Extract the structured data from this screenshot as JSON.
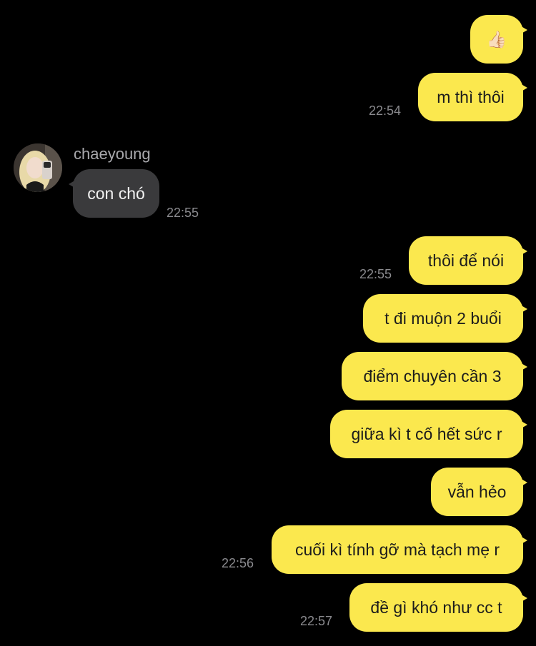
{
  "contact": {
    "name": "chaeyoung"
  },
  "messages": [
    {
      "sender": "me",
      "text": "👍🏻"
    },
    {
      "sender": "me",
      "text": "m thì thôi",
      "time": "22:54"
    },
    {
      "sender": "chaeyoung",
      "text": "con chó",
      "time": "22:55"
    },
    {
      "sender": "me",
      "text": "thôi để nói",
      "time": "22:55"
    },
    {
      "sender": "me",
      "text": "t đi muộn 2 buổi"
    },
    {
      "sender": "me",
      "text": "điểm chuyên cần 3"
    },
    {
      "sender": "me",
      "text": "giữa kì t cố hết sức r"
    },
    {
      "sender": "me",
      "text": "vẫn hẻo"
    },
    {
      "sender": "me",
      "text": "cuối kì tính gỡ mà tạch mẹ r",
      "time": "22:56"
    },
    {
      "sender": "me",
      "text": "đề gì khó như cc t",
      "time": "22:57"
    }
  ],
  "colors": {
    "background": "#000000",
    "outgoing_bubble": "#fbe84e",
    "incoming_bubble": "#3a3a3c",
    "timestamp": "#8a8a8e"
  }
}
